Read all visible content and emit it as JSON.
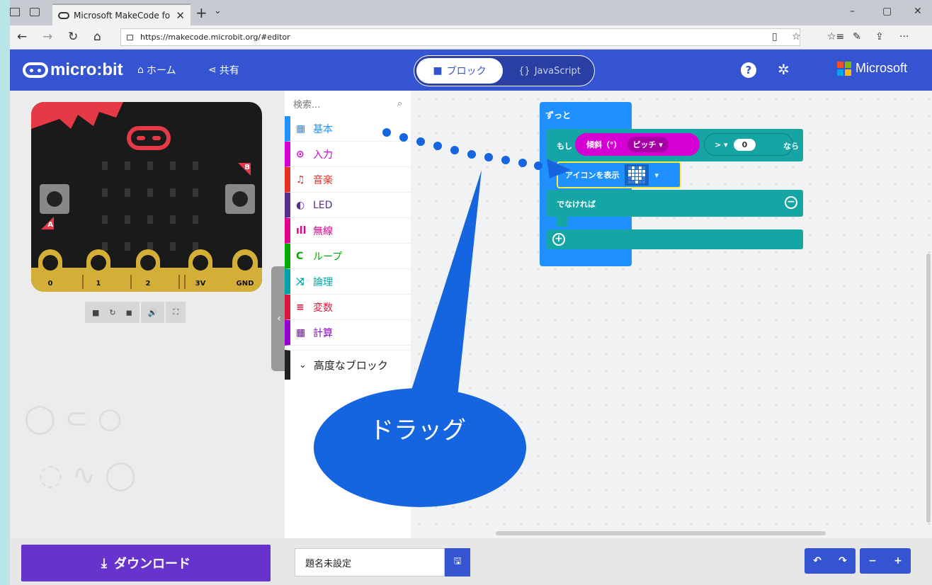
{
  "browser": {
    "tab_title": "Microsoft MakeCode fo",
    "tab_close": "✕",
    "new_tab": "+",
    "tab_menu": "⌄",
    "url": "https://makecode.microbit.org/#editor",
    "nav": {
      "back": "←",
      "forward": "→",
      "refresh": "↻",
      "home": "⌂"
    },
    "toolbar_icons": {
      "reading": "▯",
      "favorite": "☆",
      "favorites_list": "☆≡",
      "notes": "✎",
      "share": "⇪",
      "more": "···"
    },
    "window": {
      "minimize": "–",
      "maximize": "▢",
      "close": "✕"
    }
  },
  "header": {
    "logo_text": "micro:bit",
    "home_label": "ホーム",
    "share_label": "共有",
    "tab_blocks": "ブロック",
    "tab_js": "JavaScript",
    "js_icon": "{}",
    "help_icon": "?",
    "settings_icon": "✲",
    "brand": "Microsoft",
    "brand_colors": [
      "#f25022",
      "#7fba00",
      "#00a4ef",
      "#ffb900"
    ]
  },
  "simulator": {
    "pins": [
      "0",
      "1",
      "2",
      "3V",
      "GND"
    ],
    "button_a": "A",
    "button_b": "B",
    "controls": [
      "■",
      "↻",
      "◼",
      "🔊",
      "⛶"
    ],
    "collapse_icon": "‹"
  },
  "toolbox": {
    "search_placeholder": "検索...",
    "search_icon": "⌕",
    "categories": [
      {
        "label": "基本",
        "icon": "▦",
        "color": "#1e90ff"
      },
      {
        "label": "入力",
        "icon": "⊙",
        "color": "#d400d4"
      },
      {
        "label": "音楽",
        "icon": "♫",
        "color": "#e63022"
      },
      {
        "label": "LED",
        "icon": "◐",
        "color": "#5c2d91"
      },
      {
        "label": "無線",
        "icon": "ıll",
        "color": "#e3008c"
      },
      {
        "label": "ループ",
        "icon": "C",
        "color": "#00aa00"
      },
      {
        "label": "論理",
        "icon": "⤨",
        "color": "#00a4a6"
      },
      {
        "label": "変数",
        "icon": "≡",
        "color": "#dc143c"
      },
      {
        "label": "計算",
        "icon": "▦",
        "color": "#9400d3"
      }
    ],
    "advanced_label": "高度なブロック",
    "advanced_icon": "⌄"
  },
  "workspace": {
    "forever": "ずっと",
    "if": "もし",
    "tilt": "傾斜（°）",
    "tilt_dropdown": "ピッチ ▾",
    "compare_op": "> ▾",
    "compare_value": "0",
    "then": "なら",
    "show_icon": "アイコンを表示",
    "else": "でなければ",
    "minus": "−",
    "plus": "+"
  },
  "bottom": {
    "download_label": "ダウンロード",
    "download_icon": "⤓",
    "project_name": "題名未設定",
    "save_icon": "🖫",
    "undo": "↶",
    "redo": "↷",
    "zoom_out": "−",
    "zoom_in": "+"
  },
  "annotation": {
    "callout_text": "ドラッグ"
  }
}
